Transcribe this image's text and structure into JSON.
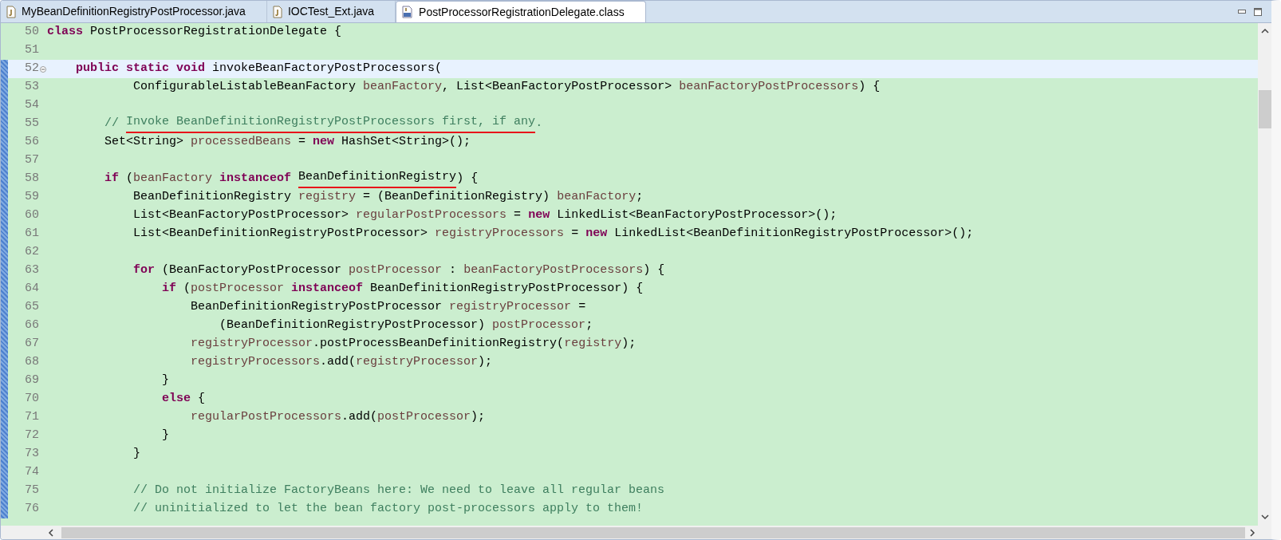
{
  "tabs": [
    {
      "label": "MyBeanDefinitionRegistryPostProcessor.java",
      "kind": "java",
      "selected": false
    },
    {
      "label": "IOCTest_Ext.java",
      "kind": "java",
      "selected": false
    },
    {
      "label": "PostProcessorRegistrationDelegate.class",
      "kind": "class",
      "selected": true
    }
  ],
  "editor": {
    "lines": [
      {
        "number": "50",
        "current": false,
        "changed": false,
        "foldable": false,
        "tokens": [
          {
            "kind": "keyword",
            "text": "class"
          },
          {
            "kind": "plain",
            "text": " PostProcessorRegistrationDelegate {"
          }
        ]
      },
      {
        "number": "51",
        "current": false,
        "changed": false,
        "foldable": false
      },
      {
        "number": "52",
        "current": true,
        "changed": true,
        "foldable": true,
        "tokens": [
          {
            "kind": "keyword",
            "text": "    public static void"
          },
          {
            "kind": "plain",
            "text": " invokeBeanFactoryPostProcessors("
          }
        ]
      },
      {
        "number": "53",
        "current": false,
        "changed": true,
        "foldable": false,
        "tokens": [
          {
            "kind": "plain",
            "text": "            ConfigurableListableBeanFactory "
          },
          {
            "kind": "local",
            "text": "beanFactory"
          },
          {
            "kind": "plain",
            "text": ", List<BeanFactoryPostProcessor> "
          },
          {
            "kind": "local",
            "text": "beanFactoryPostProcessors"
          },
          {
            "kind": "plain",
            "text": ") {"
          }
        ]
      },
      {
        "number": "54",
        "current": false,
        "changed": true,
        "foldable": false
      },
      {
        "number": "55",
        "current": false,
        "changed": true,
        "foldable": false,
        "tokens": [
          {
            "kind": "comment",
            "text": "        // "
          },
          {
            "kind": "comment",
            "text": "Invoke BeanDefinitionRegistryPostProcessors first, if any",
            "underlined": true
          },
          {
            "kind": "comment",
            "text": "."
          }
        ]
      },
      {
        "number": "56",
        "current": false,
        "changed": true,
        "foldable": false,
        "tokens": [
          {
            "kind": "plain",
            "text": "        Set<String> "
          },
          {
            "kind": "local",
            "text": "processedBeans"
          },
          {
            "kind": "plain",
            "text": " = "
          },
          {
            "kind": "keyword",
            "text": "new"
          },
          {
            "kind": "plain",
            "text": " HashSet<String>();"
          }
        ]
      },
      {
        "number": "57",
        "current": false,
        "changed": true,
        "foldable": false
      },
      {
        "number": "58",
        "current": false,
        "changed": true,
        "foldable": false,
        "tokens": [
          {
            "kind": "keyword",
            "text": "        if"
          },
          {
            "kind": "plain",
            "text": " ("
          },
          {
            "kind": "local",
            "text": "beanFactory"
          },
          {
            "kind": "keyword",
            "text": " instanceof "
          },
          {
            "kind": "plain",
            "text": "BeanDefinitionRegistry",
            "underlined": true
          },
          {
            "kind": "plain",
            "text": ") {"
          }
        ]
      },
      {
        "number": "59",
        "current": false,
        "changed": true,
        "foldable": false,
        "tokens": [
          {
            "kind": "plain",
            "text": "            BeanDefinitionRegistry "
          },
          {
            "kind": "local",
            "text": "registry"
          },
          {
            "kind": "plain",
            "text": " = (BeanDefinitionRegistry) "
          },
          {
            "kind": "local",
            "text": "beanFactory"
          },
          {
            "kind": "plain",
            "text": ";"
          }
        ]
      },
      {
        "number": "60",
        "current": false,
        "changed": true,
        "foldable": false,
        "tokens": [
          {
            "kind": "plain",
            "text": "            List<BeanFactoryPostProcessor> "
          },
          {
            "kind": "local",
            "text": "regularPostProcessors"
          },
          {
            "kind": "plain",
            "text": " = "
          },
          {
            "kind": "keyword",
            "text": "new"
          },
          {
            "kind": "plain",
            "text": " LinkedList<BeanFactoryPostProcessor>();"
          }
        ]
      },
      {
        "number": "61",
        "current": false,
        "changed": true,
        "foldable": false,
        "tokens": [
          {
            "kind": "plain",
            "text": "            List<BeanDefinitionRegistryPostProcessor> "
          },
          {
            "kind": "local",
            "text": "registryProcessors"
          },
          {
            "kind": "plain",
            "text": " = "
          },
          {
            "kind": "keyword",
            "text": "new"
          },
          {
            "kind": "plain",
            "text": " LinkedList<BeanDefinitionRegistryPostProcessor>();"
          }
        ]
      },
      {
        "number": "62",
        "current": false,
        "changed": true,
        "foldable": false
      },
      {
        "number": "63",
        "current": false,
        "changed": true,
        "foldable": false,
        "tokens": [
          {
            "kind": "keyword",
            "text": "            for"
          },
          {
            "kind": "plain",
            "text": " (BeanFactoryPostProcessor "
          },
          {
            "kind": "local",
            "text": "postProcessor"
          },
          {
            "kind": "plain",
            "text": " : "
          },
          {
            "kind": "local",
            "text": "beanFactoryPostProcessors"
          },
          {
            "kind": "plain",
            "text": ") {"
          }
        ]
      },
      {
        "number": "64",
        "current": false,
        "changed": true,
        "foldable": false,
        "tokens": [
          {
            "kind": "keyword",
            "text": "                if"
          },
          {
            "kind": "plain",
            "text": " ("
          },
          {
            "kind": "local",
            "text": "postProcessor"
          },
          {
            "kind": "keyword",
            "text": " instanceof"
          },
          {
            "kind": "plain",
            "text": " BeanDefinitionRegistryPostProcessor) {"
          }
        ]
      },
      {
        "number": "65",
        "current": false,
        "changed": true,
        "foldable": false,
        "tokens": [
          {
            "kind": "plain",
            "text": "                    BeanDefinitionRegistryPostProcessor "
          },
          {
            "kind": "local",
            "text": "registryProcessor"
          },
          {
            "kind": "plain",
            "text": " ="
          }
        ]
      },
      {
        "number": "66",
        "current": false,
        "changed": true,
        "foldable": false,
        "tokens": [
          {
            "kind": "plain",
            "text": "                        (BeanDefinitionRegistryPostProcessor) "
          },
          {
            "kind": "local",
            "text": "postProcessor"
          },
          {
            "kind": "plain",
            "text": ";"
          }
        ]
      },
      {
        "number": "67",
        "current": false,
        "changed": true,
        "foldable": false,
        "tokens": [
          {
            "kind": "local",
            "text": "                    registryProcessor"
          },
          {
            "kind": "plain",
            "text": ".postProcessBeanDefinitionRegistry("
          },
          {
            "kind": "local",
            "text": "registry"
          },
          {
            "kind": "plain",
            "text": ");"
          }
        ]
      },
      {
        "number": "68",
        "current": false,
        "changed": true,
        "foldable": false,
        "tokens": [
          {
            "kind": "local",
            "text": "                    registryProcessors"
          },
          {
            "kind": "plain",
            "text": ".add("
          },
          {
            "kind": "local",
            "text": "registryProcessor"
          },
          {
            "kind": "plain",
            "text": ");"
          }
        ]
      },
      {
        "number": "69",
        "current": false,
        "changed": true,
        "foldable": false,
        "tokens": [
          {
            "kind": "plain",
            "text": "                }"
          }
        ]
      },
      {
        "number": "70",
        "current": false,
        "changed": true,
        "foldable": false,
        "tokens": [
          {
            "kind": "keyword",
            "text": "                else"
          },
          {
            "kind": "plain",
            "text": " {"
          }
        ]
      },
      {
        "number": "71",
        "current": false,
        "changed": true,
        "foldable": false,
        "tokens": [
          {
            "kind": "local",
            "text": "                    regularPostProcessors"
          },
          {
            "kind": "plain",
            "text": ".add("
          },
          {
            "kind": "local",
            "text": "postProcessor"
          },
          {
            "kind": "plain",
            "text": ");"
          }
        ]
      },
      {
        "number": "72",
        "current": false,
        "changed": true,
        "foldable": false,
        "tokens": [
          {
            "kind": "plain",
            "text": "                }"
          }
        ]
      },
      {
        "number": "73",
        "current": false,
        "changed": true,
        "foldable": false,
        "tokens": [
          {
            "kind": "plain",
            "text": "            }"
          }
        ]
      },
      {
        "number": "74",
        "current": false,
        "changed": true,
        "foldable": false
      },
      {
        "number": "75",
        "current": false,
        "changed": true,
        "foldable": false,
        "tokens": [
          {
            "kind": "comment",
            "text": "            // Do not initialize FactoryBeans here: We need to leave all regular beans"
          }
        ]
      },
      {
        "number": "76",
        "current": false,
        "changed": true,
        "foldable": false,
        "tokens": [
          {
            "kind": "comment",
            "text": "            // uninitialized to let the bean factory post-processors apply to them!"
          }
        ]
      }
    ]
  }
}
